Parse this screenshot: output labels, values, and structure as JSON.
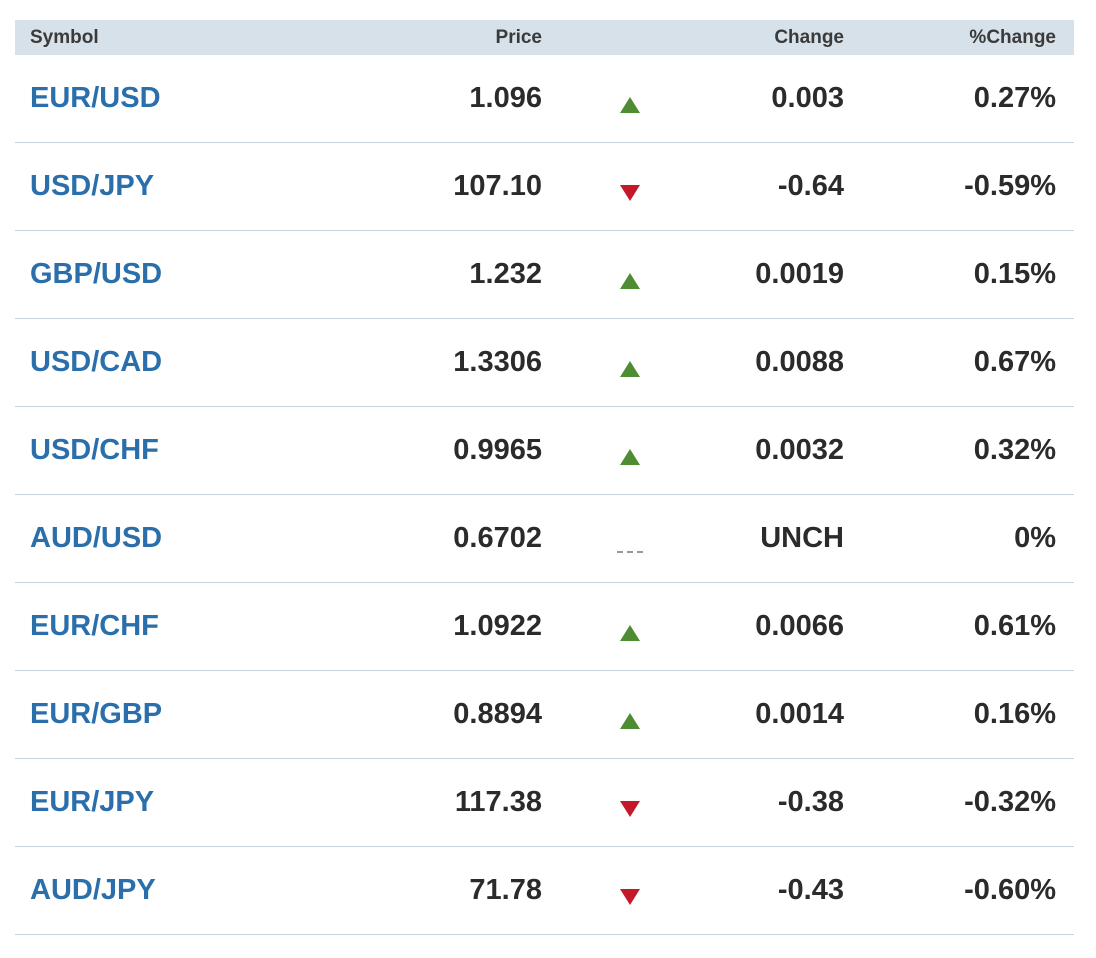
{
  "table": {
    "headers": {
      "symbol": "Symbol",
      "price": "Price",
      "change": "Change",
      "pct_change": "%Change"
    },
    "rows": [
      {
        "symbol": "EUR/USD",
        "price": "1.096",
        "direction": "up",
        "change": "0.003",
        "pct_change": "0.27%"
      },
      {
        "symbol": "USD/JPY",
        "price": "107.10",
        "direction": "down",
        "change": "-0.64",
        "pct_change": "-0.59%"
      },
      {
        "symbol": "GBP/USD",
        "price": "1.232",
        "direction": "up",
        "change": "0.0019",
        "pct_change": "0.15%"
      },
      {
        "symbol": "USD/CAD",
        "price": "1.3306",
        "direction": "up",
        "change": "0.0088",
        "pct_change": "0.67%"
      },
      {
        "symbol": "USD/CHF",
        "price": "0.9965",
        "direction": "up",
        "change": "0.0032",
        "pct_change": "0.32%"
      },
      {
        "symbol": "AUD/USD",
        "price": "0.6702",
        "direction": "flat",
        "change": "UNCH",
        "pct_change": "0%"
      },
      {
        "symbol": "EUR/CHF",
        "price": "1.0922",
        "direction": "up",
        "change": "0.0066",
        "pct_change": "0.61%"
      },
      {
        "symbol": "EUR/GBP",
        "price": "0.8894",
        "direction": "up",
        "change": "0.0014",
        "pct_change": "0.16%"
      },
      {
        "symbol": "EUR/JPY",
        "price": "117.38",
        "direction": "down",
        "change": "-0.38",
        "pct_change": "-0.32%"
      },
      {
        "symbol": "AUD/JPY",
        "price": "71.78",
        "direction": "down",
        "change": "-0.43",
        "pct_change": "-0.60%"
      }
    ]
  },
  "colors": {
    "header_bg": "#d6e1ea",
    "symbol_link": "#2a6fab",
    "up": "#4e8c33",
    "down": "#c4192a",
    "unchanged": "#9a9a9a",
    "row_divider": "#c6d2dc"
  },
  "icons": {
    "up": "up-triangle-icon",
    "down": "down-triangle-icon",
    "flat": "unchanged-dash-icon"
  }
}
